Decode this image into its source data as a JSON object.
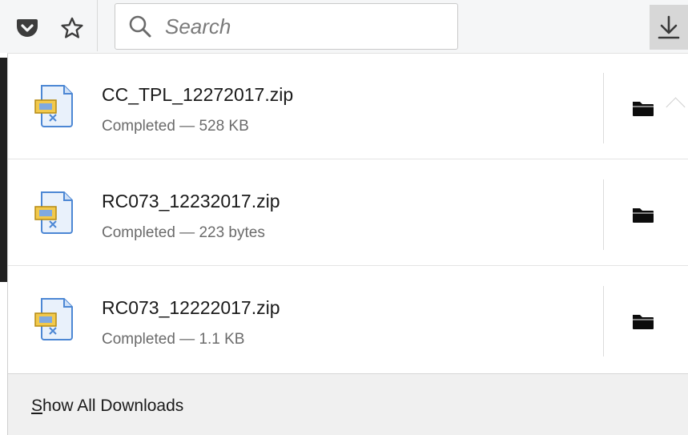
{
  "toolbar": {
    "search_placeholder": "Search",
    "icons": {
      "pocket": "pocket-icon",
      "bookmark": "star-icon",
      "search": "search-icon",
      "downloads": "download-arrow-icon"
    }
  },
  "downloads": {
    "items": [
      {
        "name": "CC_TPL_12272017.zip",
        "status": "Completed — 528 KB",
        "icon": "zip-file-icon",
        "action_icon": "folder-icon"
      },
      {
        "name": "RC073_12232017.zip",
        "status": "Completed — 223 bytes",
        "icon": "zip-file-icon",
        "action_icon": "folder-icon"
      },
      {
        "name": "RC073_12222017.zip",
        "status": "Completed — 1.1 KB",
        "icon": "zip-file-icon",
        "action_icon": "folder-icon"
      }
    ],
    "show_all_accesskey": "S",
    "show_all_rest": "how All Downloads"
  }
}
